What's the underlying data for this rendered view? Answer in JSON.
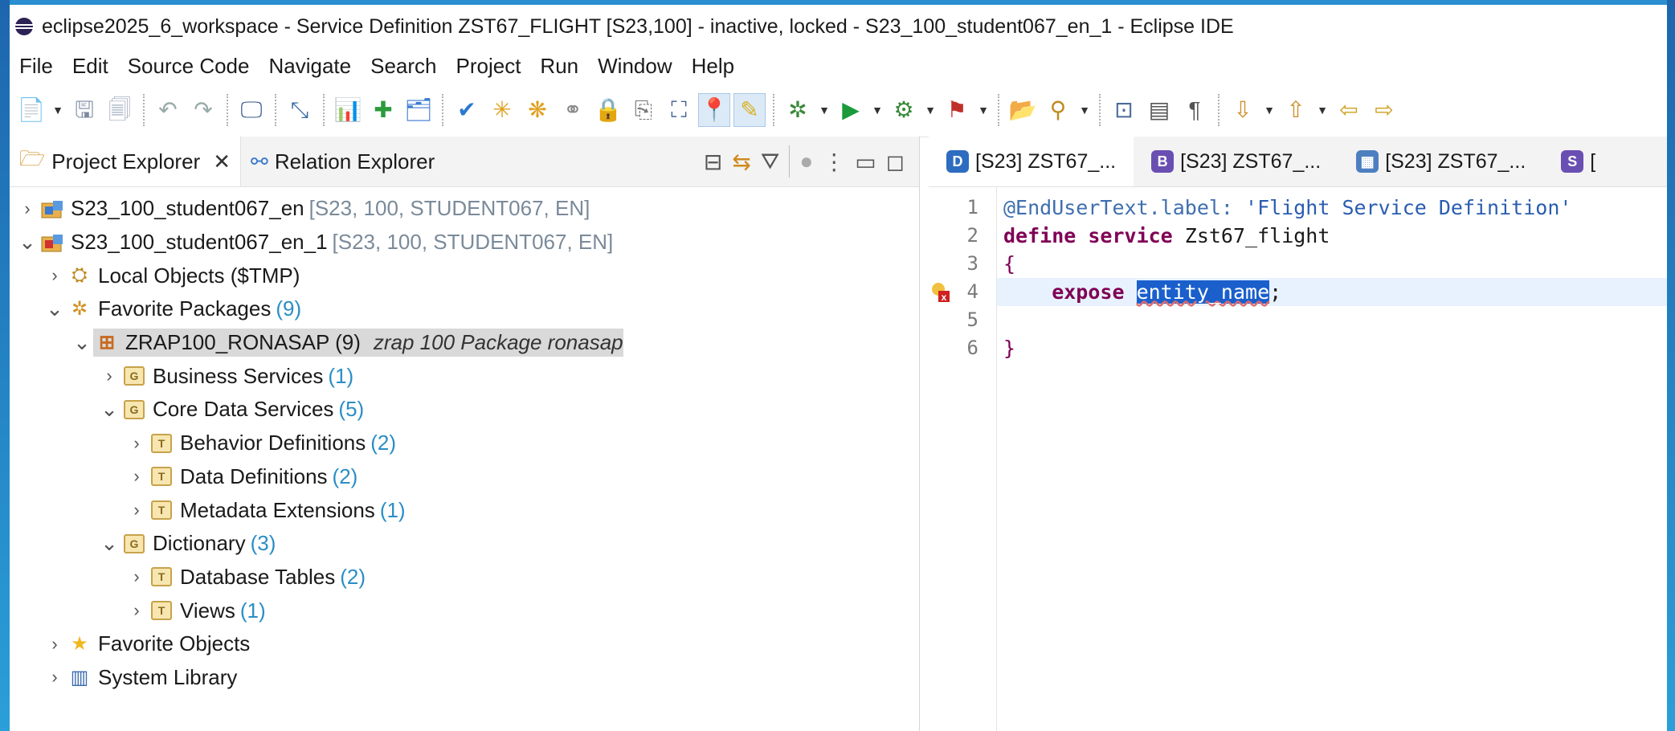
{
  "window": {
    "title": "eclipse2025_6_workspace - Service Definition ZST67_FLIGHT [S23,100] - inactive, locked - S23_100_student067_en_1 - Eclipse IDE"
  },
  "menu": [
    "File",
    "Edit",
    "Source Code",
    "Navigate",
    "Search",
    "Project",
    "Run",
    "Window",
    "Help"
  ],
  "left_panel": {
    "tabs": [
      {
        "label": "Project Explorer",
        "icon": "project-explorer-icon",
        "active": true
      },
      {
        "label": "Relation Explorer",
        "icon": "relation-explorer-icon",
        "active": false
      }
    ],
    "tree": [
      {
        "label": "S23_100_student067_en",
        "decoration": "[S23, 100, STUDENT067, EN]",
        "expanded": false,
        "level": 0,
        "icon": "abap-project-icon"
      },
      {
        "label": "S23_100_student067_en_1",
        "decoration": "[S23, 100, STUDENT067, EN]",
        "expanded": true,
        "level": 0,
        "icon": "abap-project-error-icon"
      },
      {
        "label": "Local Objects ($TMP)",
        "expanded": false,
        "level": 1,
        "icon": "local-objects-icon"
      },
      {
        "label": "Favorite Packages",
        "count": "(9)",
        "expanded": true,
        "level": 1,
        "icon": "favorite-packages-icon"
      },
      {
        "label": "ZRAP100_RONASAP (9)",
        "description": "zrap 100 Package ronasap",
        "expanded": true,
        "level": 2,
        "icon": "package-icon",
        "selected": true
      },
      {
        "label": "Business Services",
        "count": "(1)",
        "expanded": false,
        "level": 3,
        "icon": "group-folder-icon"
      },
      {
        "label": "Core Data Services",
        "count": "(5)",
        "expanded": true,
        "level": 3,
        "icon": "group-folder-icon"
      },
      {
        "label": "Behavior Definitions",
        "count": "(2)",
        "expanded": false,
        "level": 4,
        "icon": "type-folder-icon"
      },
      {
        "label": "Data Definitions",
        "count": "(2)",
        "expanded": false,
        "level": 4,
        "icon": "type-folder-icon"
      },
      {
        "label": "Metadata Extensions",
        "count": "(1)",
        "expanded": false,
        "level": 4,
        "icon": "type-folder-icon"
      },
      {
        "label": "Dictionary",
        "count": "(3)",
        "expanded": true,
        "level": 3,
        "icon": "group-folder-icon"
      },
      {
        "label": "Database Tables",
        "count": "(2)",
        "expanded": false,
        "level": 4,
        "icon": "type-folder-icon"
      },
      {
        "label": "Views",
        "count": "(1)",
        "expanded": false,
        "level": 4,
        "icon": "type-folder-icon"
      },
      {
        "label": "Favorite Objects",
        "expanded": false,
        "level": 1,
        "icon": "star-icon"
      },
      {
        "label": "System Library",
        "expanded": false,
        "level": 1,
        "icon": "system-library-icon"
      }
    ]
  },
  "editor": {
    "tabs": [
      {
        "label": "[S23] ZST67_...",
        "icon_letter": "D",
        "color": "#2d6cc0",
        "active": true
      },
      {
        "label": "[S23] ZST67_...",
        "icon_letter": "B",
        "color": "#6a4fb3",
        "active": false
      },
      {
        "label": "[S23] ZST67_...",
        "icon_letter": "▦",
        "color": "#4d7fc0",
        "active": false
      },
      {
        "label": "[",
        "icon_letter": "S",
        "color": "#6a4fb3",
        "active": false
      }
    ],
    "lines": [
      {
        "no": "1",
        "parts": [
          {
            "t": "@EndUserText.label: ",
            "c": "annot"
          },
          {
            "t": "'Flight Service Definition'",
            "c": "str"
          }
        ]
      },
      {
        "no": "2",
        "parts": [
          {
            "t": "define service ",
            "c": "kw"
          },
          {
            "t": "Zst67_flight",
            "c": "plain"
          }
        ]
      },
      {
        "no": "3",
        "parts": [
          {
            "t": "{",
            "c": "brace"
          }
        ]
      },
      {
        "no": "4",
        "parts": [
          {
            "t": "    expose ",
            "c": "kw"
          },
          {
            "t": "entity_name",
            "c": "sel"
          },
          {
            "t": ";",
            "c": "plain"
          }
        ],
        "error": true,
        "current": true
      },
      {
        "no": "5",
        "parts": []
      },
      {
        "no": "6",
        "parts": [
          {
            "t": "}",
            "c": "brace"
          }
        ]
      }
    ]
  }
}
